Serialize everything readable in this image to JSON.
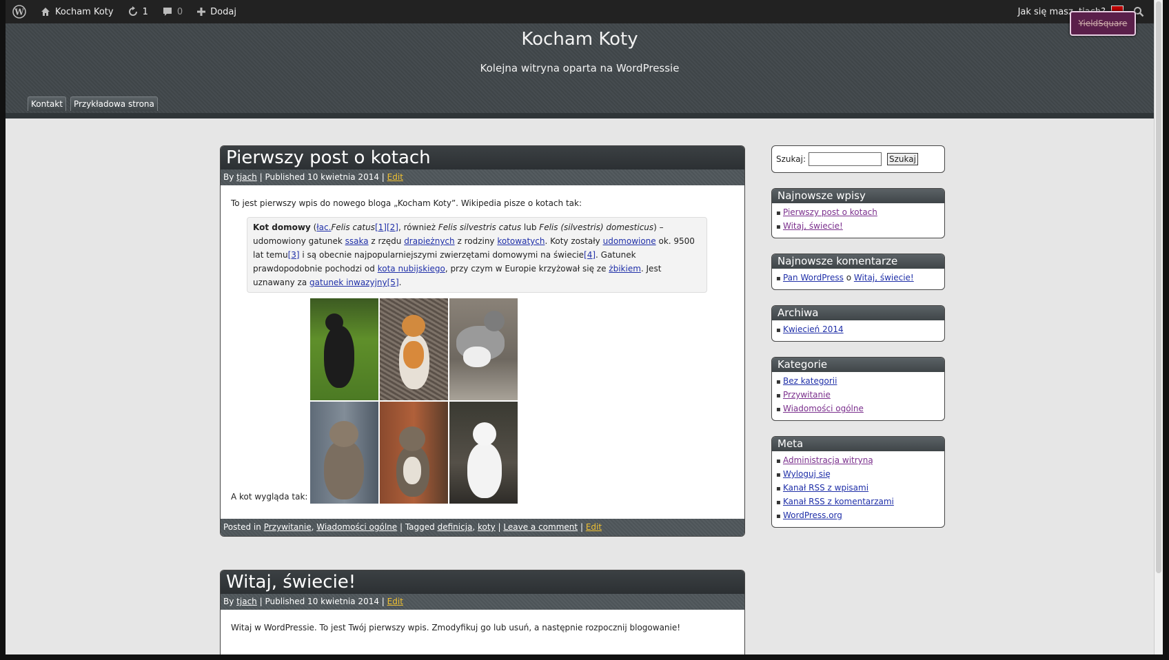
{
  "admin_bar": {
    "site_name": "Kocham Koty",
    "updates_count": "1",
    "comments_count": "0",
    "new_label": "Dodaj",
    "greeting": "Jak się masz, tjach?",
    "overlay_label": "YieldSquare"
  },
  "header": {
    "title": "Kocham Koty",
    "tagline": "Kolejna witryna oparta na WordPressie",
    "nav": [
      "Kontakt",
      "Przykładowa strona"
    ]
  },
  "post1": {
    "title": "Pierwszy post o kotach",
    "meta": {
      "by": "By",
      "author": "tjach",
      "published": "| Published 10 kwietnia 2014 |",
      "edit": "Edit"
    },
    "intro": "To jest pierwszy wpis do nowego bloga „Kocham Koty”. Wikipedia pisze o kotach tak:",
    "quote": {
      "t1": "Kot domowy",
      "t2": " (",
      "l1": "łac.",
      "t3": "Felis catus",
      "l2": "[1][2]",
      "t4": ", również ",
      "t5": "Felis silvestris catus",
      "t6": " lub ",
      "t7": "Felis (silvestris) domesticus",
      "t8": ") – udomowiony gatunek ",
      "l3": "ssaka",
      "t9": " z rzędu ",
      "l4": "drapieżnych",
      "t10": " z rodziny ",
      "l5": "kotowatych",
      "t11": ". Koty zostały ",
      "l6": "udomowione",
      "t12": " ok. 9500 lat temu",
      "l7": "[3]",
      "t13": " i są obecnie najpopularniejszymi zwierzętami domowymi na świecie",
      "l8": "[4]",
      "t14": ". Gatunek prawdopodobnie pochodzi od ",
      "l9": "kota nubijskiego",
      "t15": ", przy czym w Europie krzyżował się ze ",
      "l10": "żbikiem",
      "t16": ". Jest uznawany za ",
      "l11": "gatunek inwazyjny",
      "l12": "[5]",
      "t17": "."
    },
    "caption": "A kot wygląda tak:",
    "footer": {
      "posted_in": "Posted in",
      "cat1": "Przywitanie",
      "cat2": "Wiadomości ogólne",
      "tagged": "| Tagged",
      "tag1": "definicja",
      "tag2": "koty",
      "sep": "|",
      "comment": "Leave a comment",
      "edit": "Edit"
    }
  },
  "post2": {
    "title": "Witaj, świecie!",
    "meta": {
      "by": "By",
      "author": "tjach",
      "published": "| Published 10 kwietnia 2014 |",
      "edit": "Edit"
    },
    "body": "Witaj w WordPressie. To jest Twój pierwszy wpis. Zmodyfikuj go lub usuń, a następnie rozpocznij blogowanie!"
  },
  "sidebar": {
    "search_label": "Szukaj:",
    "search_button": "Szukaj",
    "recent_posts_title": "Najnowsze wpisy",
    "recent_posts": [
      "Pierwszy post o kotach",
      "Witaj, świecie!"
    ],
    "recent_comments_title": "Najnowsze komentarze",
    "recent_comment": {
      "author": "Pan WordPress",
      "on": " o ",
      "post": "Witaj, świecie!"
    },
    "archives_title": "Archiwa",
    "archives": [
      "Kwiecień 2014"
    ],
    "categories_title": "Kategorie",
    "categories": [
      "Bez kategorii",
      "Przywitanie",
      "Wiadomości ogólne"
    ],
    "meta_title": "Meta",
    "meta": [
      "Administracja witryną",
      "Wyloguj się",
      "Kanał RSS z wpisami",
      "Kanał RSS z komentarzami",
      "WordPress.org"
    ]
  },
  "colors": {
    "accent": "#f1c232",
    "link": "#1f2fa8",
    "dark": "#2c3033"
  }
}
